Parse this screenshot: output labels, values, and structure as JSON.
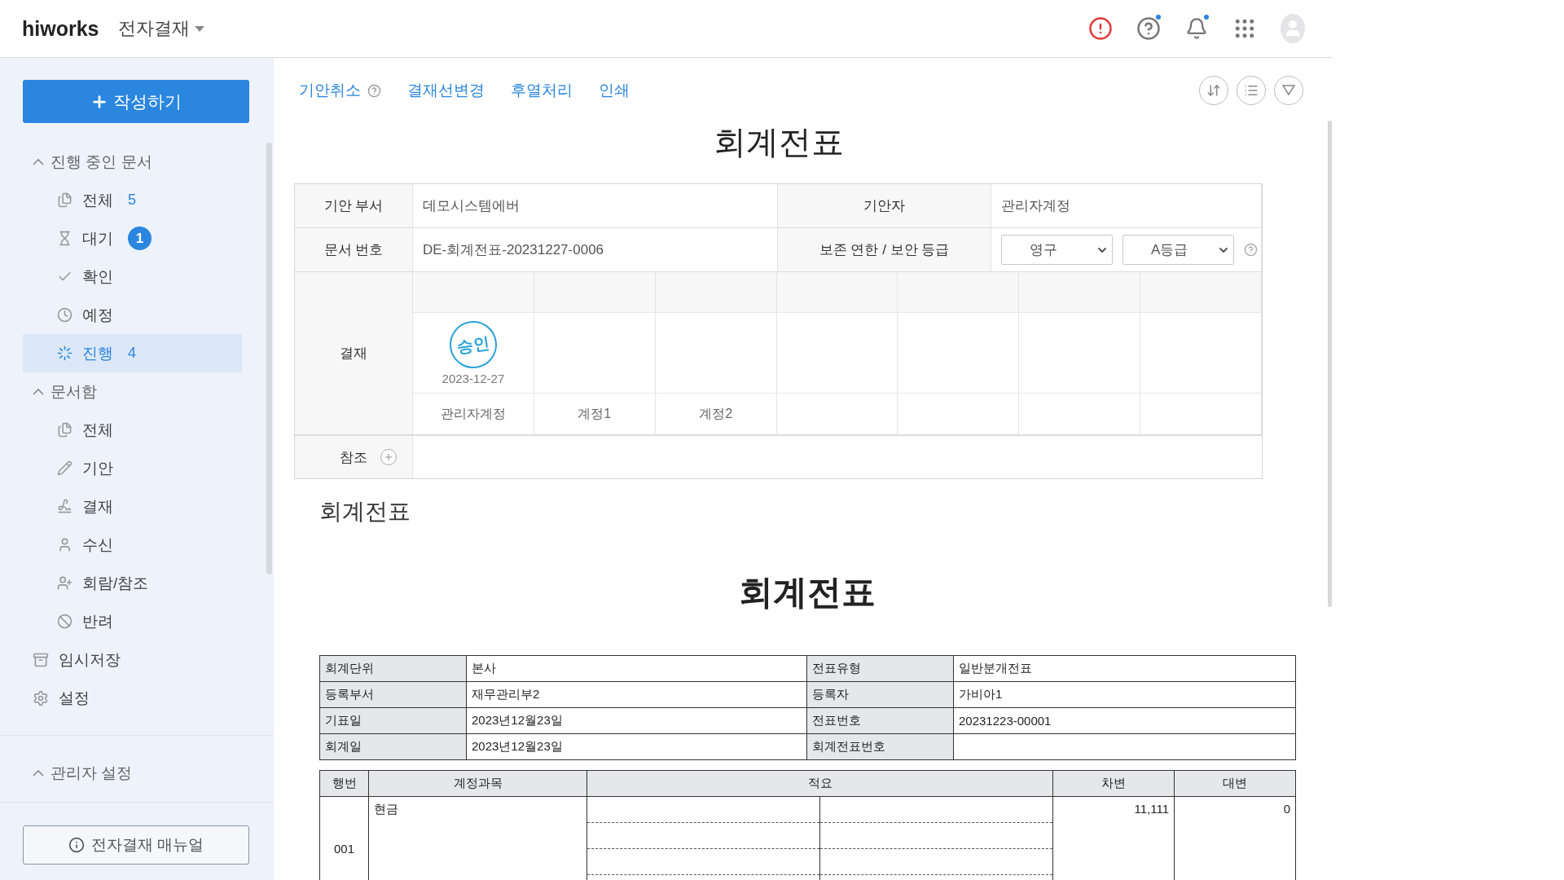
{
  "header": {
    "logo": "hiworks",
    "app_menu": "전자결재",
    "icons": [
      {
        "dot": false
      },
      {
        "dot": true
      },
      {
        "dot": true
      },
      {
        "dot": false
      },
      {
        "dot": false
      }
    ]
  },
  "sidebar": {
    "write_button": "작성하기",
    "sections": [
      {
        "label": "진행 중인 문서",
        "expanded": true,
        "children": [
          {
            "label": "전체",
            "count": "5",
            "selected": false
          },
          {
            "label": "대기",
            "badge": "1",
            "selected": false
          },
          {
            "label": "확인",
            "selected": false
          },
          {
            "label": "예정",
            "selected": false
          },
          {
            "label": "진행",
            "count": "4",
            "selected": true
          }
        ]
      },
      {
        "label": "문서함",
        "expanded": true,
        "children": [
          {
            "label": "전체",
            "selected": false
          },
          {
            "label": "기안",
            "selected": false
          },
          {
            "label": "결재",
            "selected": false
          },
          {
            "label": "수신",
            "selected": false
          },
          {
            "label": "회람/참조",
            "selected": false
          },
          {
            "label": "반려",
            "selected": false
          }
        ]
      }
    ],
    "top_items": [
      {
        "label": "임시저장",
        "selected": false
      },
      {
        "label": "설정",
        "selected": false
      }
    ],
    "admin_section": {
      "label": "관리자 설정",
      "expanded": true
    },
    "manual_button": "전자결재 매뉴얼"
  },
  "toolbar": {
    "links": [
      {
        "label": "기안취소",
        "help": true
      },
      {
        "label": "결재선변경",
        "help": false
      },
      {
        "label": "후열처리",
        "help": false
      },
      {
        "label": "인쇄",
        "help": false
      }
    ]
  },
  "document": {
    "title": "회계전표",
    "info_rows": [
      {
        "label_1": "기안 부서",
        "value_1": "데모시스템에버",
        "label_2": "기안자",
        "value_2": "관리자계정"
      },
      {
        "label_1": "문서 번호",
        "value_1": "DE-회계전표-20231227-0006",
        "label_2": "보존 연한 / 보안 등급",
        "retention": "영구",
        "security": "A등급"
      }
    ],
    "approval": {
      "label": "결재",
      "approvers": [
        {
          "name": "관리자계정",
          "approved": true,
          "stamp": "승인",
          "date": "2023-12-27"
        },
        {
          "name": "계정1",
          "approved": false
        },
        {
          "name": "계정2",
          "approved": false
        }
      ]
    },
    "reference": {
      "label": "참조"
    }
  },
  "form": {
    "section_title": "회계전표",
    "title": "회계전표",
    "info_rows": [
      [
        "회계단위",
        "본사",
        "전표유형",
        "일반분개전표"
      ],
      [
        "등록부서",
        "재무관리부2",
        "등록자",
        "가비아1"
      ],
      [
        "기표일",
        "2023년12월23일",
        "전표번호",
        "20231223-00001"
      ],
      [
        "회계일",
        "2023년12월23일",
        "회계전표번호",
        null
      ]
    ],
    "line_columns": [
      "행번",
      "계정과목",
      "적요",
      "차변",
      "대변"
    ],
    "lines": [
      {
        "no": "001",
        "account": "현금",
        "debit": "11,111",
        "credit": "0"
      }
    ]
  }
}
